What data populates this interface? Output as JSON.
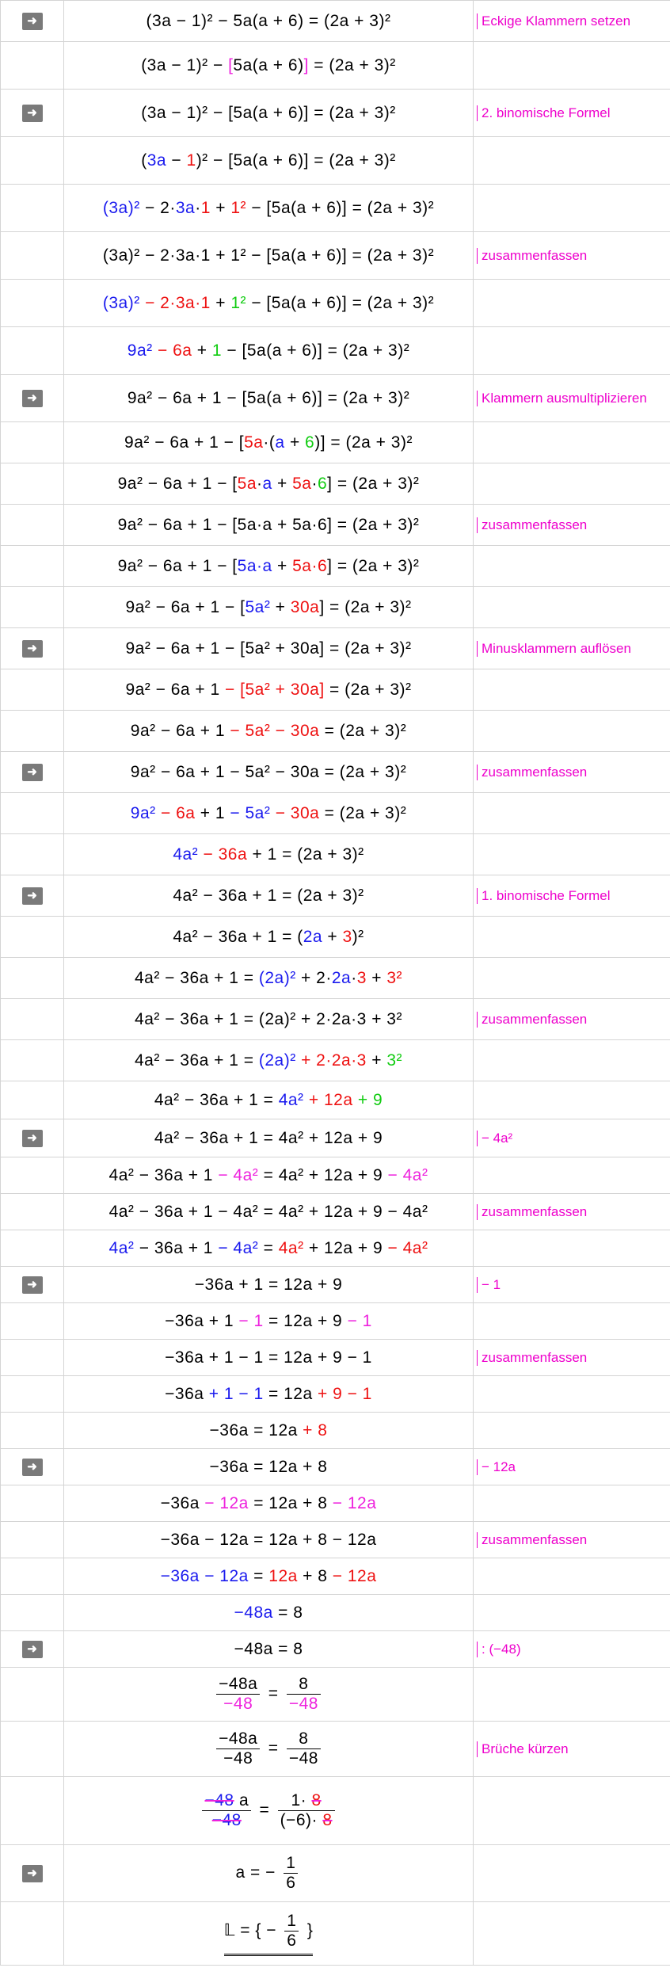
{
  "notes": {
    "n1": "Eckige Klammern setzen",
    "n2": "2. binomische Formel",
    "n3": "zusammenfassen",
    "n4": "Klammern ausmultiplizieren",
    "n5": "zusammenfassen",
    "n6": "Minusklammern auflösen",
    "n7": "zusammenfassen",
    "n8": "1. binomische Formel",
    "n9": "zusammenfassen",
    "n10": "− 4a²",
    "n11": "zusammenfassen",
    "n12": "− 1",
    "n13": "zusammenfassen",
    "n14": "− 12a",
    "n15": "zusammenfassen",
    "n16": ": (−48)",
    "n17": "Brüche kürzen"
  },
  "icon": {
    "glyph": "↦",
    "name": "step-arrow-icon"
  },
  "colors": {
    "blue": "#1a1aee",
    "red": "#ee1111",
    "green": "#11cc11",
    "magenta": "#ee22dd"
  }
}
